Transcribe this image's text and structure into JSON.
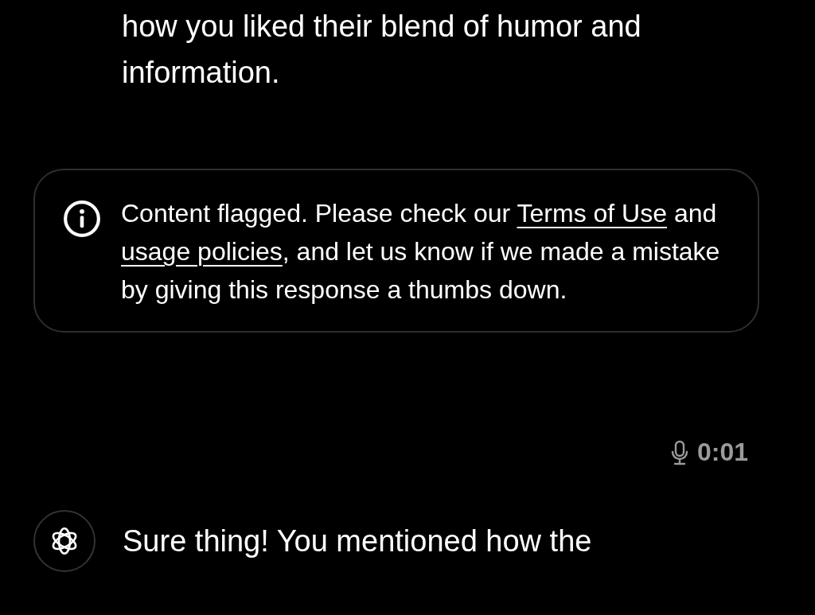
{
  "messages_above": {
    "text": "how you liked their blend of humor and information."
  },
  "notice": {
    "parts": [
      {
        "kind": "text",
        "text": "Content flagged. Please check our "
      },
      {
        "kind": "link",
        "text": "Terms of Use"
      },
      {
        "kind": "text",
        "text": " and "
      },
      {
        "kind": "link",
        "text": "usage policies"
      },
      {
        "kind": "text",
        "text": ", and let us know if we made a mistake by giving this response a thumbs down."
      }
    ]
  },
  "voice_message": {
    "duration": "0:01"
  },
  "assistant_message": {
    "text": "Sure thing! You mentioned how the"
  }
}
